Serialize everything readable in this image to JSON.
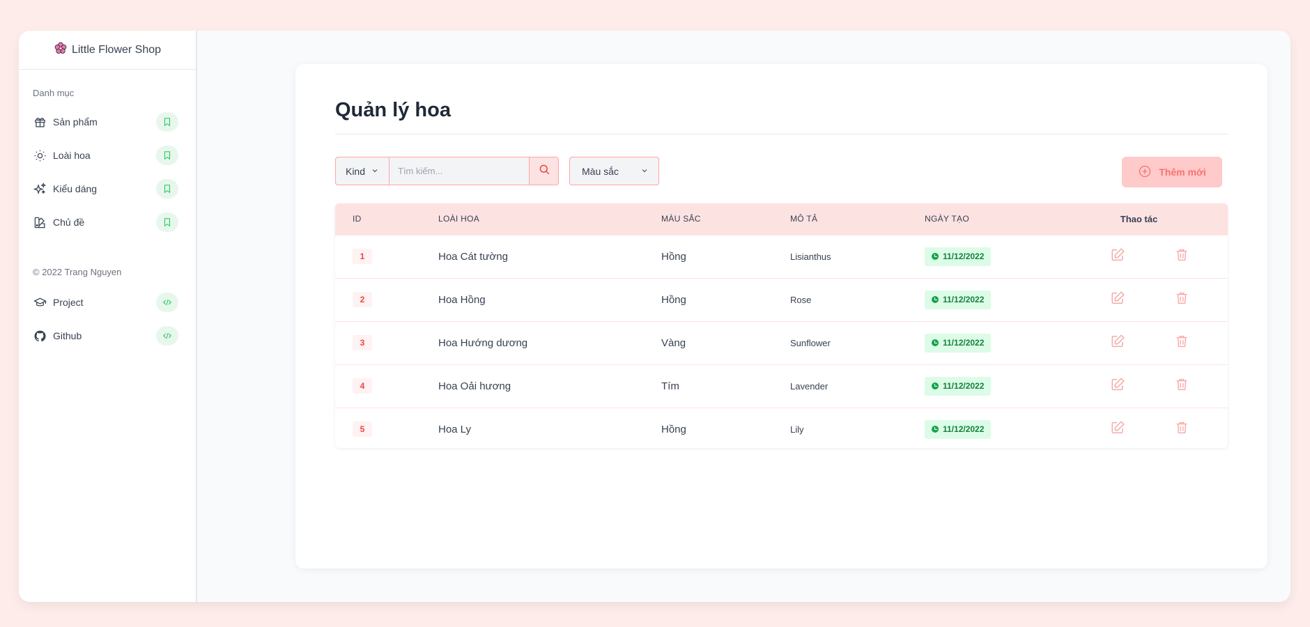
{
  "brand": {
    "name": "Little Flower Shop",
    "icon": "flower-icon"
  },
  "sidebar": {
    "section_label": "Danh mục",
    "items": [
      {
        "label": "Sản phẩm",
        "icon": "gift-icon"
      },
      {
        "label": "Loài hoa",
        "icon": "sun-icon"
      },
      {
        "label": "Kiểu dáng",
        "icon": "sparkles-icon"
      },
      {
        "label": "Chủ đề",
        "icon": "swatch-icon"
      }
    ],
    "copyright": "© 2022 Trang Nguyen",
    "links": [
      {
        "label": "Project",
        "icon": "academic-cap-icon"
      },
      {
        "label": "Github",
        "icon": "github-icon"
      }
    ]
  },
  "page": {
    "title": "Quản lý hoa"
  },
  "toolbar": {
    "kind_label": "Kind",
    "search_placeholder": "Tìm kiếm...",
    "color_label": "Màu sắc",
    "add_label": "Thêm mới"
  },
  "table": {
    "headers": {
      "id": "ID",
      "name": "LOÀI HOA",
      "color": "MÀU SẮC",
      "desc": "MÔ TẢ",
      "date": "NGÀY TẠO",
      "actions": "Thao tác"
    },
    "rows": [
      {
        "id": "1",
        "name": "Hoa Cát tường",
        "color": "Hồng",
        "desc": "Lisianthus",
        "date": "11/12/2022"
      },
      {
        "id": "2",
        "name": "Hoa Hồng",
        "color": "Hồng",
        "desc": "Rose",
        "date": "11/12/2022"
      },
      {
        "id": "3",
        "name": "Hoa Hướng dương",
        "color": "Vàng",
        "desc": "Sunflower",
        "date": "11/12/2022"
      },
      {
        "id": "4",
        "name": "Hoa Oải hương",
        "color": "Tím",
        "desc": "Lavender",
        "date": "11/12/2022"
      },
      {
        "id": "5",
        "name": "Hoa Ly",
        "color": "Hồng",
        "desc": "Lily",
        "date": "11/12/2022"
      }
    ]
  },
  "colors": {
    "accent": "#ef4444",
    "header_bg": "#fde2e2",
    "date_badge_bg": "#dcfce7",
    "date_badge_text": "#15803d",
    "page_bg": "#fdece9"
  }
}
